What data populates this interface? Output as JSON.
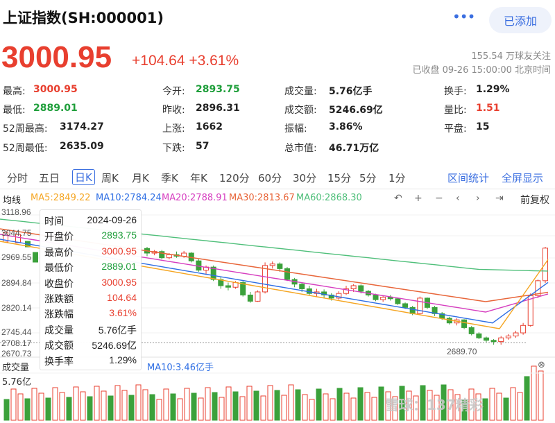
{
  "header": {
    "title": "上证指数(SH:000001)",
    "more_icon": "more-dots-icon",
    "add_label": "已添加"
  },
  "quote": {
    "price": "3000.95",
    "change": "+104.64",
    "change_pct": "+3.61%",
    "followers": "155.54 万球友关注",
    "status": "已收盘 09-26 15:00:00 北京时间"
  },
  "stats": [
    {
      "label": "最高:",
      "value": "3000.95",
      "tone": "up"
    },
    {
      "label": "今开:",
      "value": "2893.75",
      "tone": "down"
    },
    {
      "label": "成交量:",
      "value": "5.76亿手",
      "tone": ""
    },
    {
      "label": "换手:",
      "value": "1.29%",
      "tone": ""
    },
    {
      "label": "最低:",
      "value": "2889.01",
      "tone": "down"
    },
    {
      "label": "昨收:",
      "value": "2896.31",
      "tone": ""
    },
    {
      "label": "成交额:",
      "value": "5246.69亿",
      "tone": ""
    },
    {
      "label": "量比:",
      "value": "1.51",
      "tone": "up"
    },
    {
      "label": "52周最高:",
      "value": "3174.27",
      "tone": ""
    },
    {
      "label": "上涨:",
      "value": "1662",
      "tone": ""
    },
    {
      "label": "振幅:",
      "value": "3.86%",
      "tone": ""
    },
    {
      "label": "平盘:",
      "value": "15",
      "tone": ""
    },
    {
      "label": "52周最低:",
      "value": "2635.09",
      "tone": ""
    },
    {
      "label": "下跌:",
      "value": "57",
      "tone": ""
    },
    {
      "label": "总市值:",
      "value": "46.71万亿",
      "tone": ""
    }
  ],
  "tabs": [
    "分时",
    "五日",
    "日K",
    "周K",
    "月K",
    "季K",
    "年K",
    "120分",
    "60分",
    "30分",
    "15分",
    "5分",
    "1分"
  ],
  "active_tab": "日K",
  "right_tabs": [
    "区间统计",
    "全屏显示"
  ],
  "ma_bar": {
    "avg_label": "均线",
    "items": [
      {
        "text": "MA5:2849.22",
        "color": "#f5a623"
      },
      {
        "text": "MA10:2784.24",
        "color": "#2f6fe4"
      },
      {
        "text": "MA20:2788.91",
        "color": "#d63fc0"
      },
      {
        "text": "MA30:2813.67",
        "color": "#e8663a"
      },
      {
        "text": "MA60:2868.30",
        "color": "#4fbf7a"
      }
    ],
    "controls": [
      "↶",
      "+",
      "−",
      "‹",
      "›",
      "⇥"
    ],
    "fq_label": "前复权"
  },
  "axis": {
    "labels": [
      "3118.96",
      "3044.75",
      "2969.55",
      "2894.84",
      "2820.14",
      "2745.44",
      "2708.17",
      "2670.73"
    ],
    "low_marker": "2689.70"
  },
  "tooltip": [
    {
      "k": "时间",
      "v": "2024-09-26",
      "tone": ""
    },
    {
      "k": "开盘价",
      "v": "2893.75",
      "tone": "down"
    },
    {
      "k": "最高价",
      "v": "3000.95",
      "tone": "up"
    },
    {
      "k": "最低价",
      "v": "2889.01",
      "tone": "down"
    },
    {
      "k": "收盘价",
      "v": "3000.95",
      "tone": "up"
    },
    {
      "k": "涨跌额",
      "v": "104.64",
      "tone": "up"
    },
    {
      "k": "涨跌幅",
      "v": "3.61%",
      "tone": "up"
    },
    {
      "k": "成交量",
      "v": "5.76亿手",
      "tone": ""
    },
    {
      "k": "成交额",
      "v": "5246.69亿",
      "tone": ""
    },
    {
      "k": "换手率",
      "v": "1.29%",
      "tone": ""
    }
  ],
  "volume": {
    "label": "成交量",
    "ma10": "MA10:3.46亿手",
    "max_label": "5.76亿"
  },
  "watermark": "雪球：137精彩"
}
